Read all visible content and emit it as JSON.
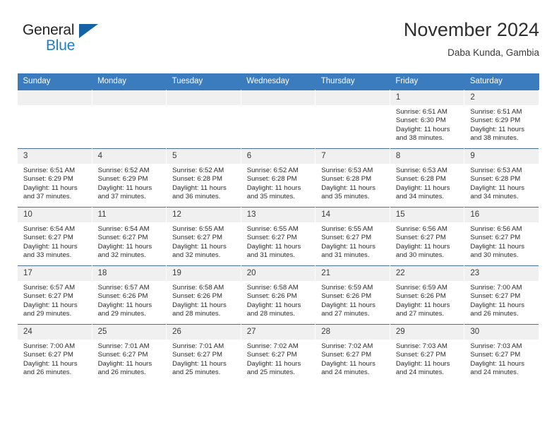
{
  "brand": {
    "name_part1": "General",
    "name_part2": "Blue",
    "logo_icon": "triangle-flag-icon"
  },
  "header": {
    "month_title": "November 2024",
    "location": "Daba Kunda, Gambia"
  },
  "colors": {
    "header_blue": "#3b7cbf",
    "brand_blue": "#1f7fc4",
    "logo_blue": "#1464a5",
    "daynum_band": "#f0f0f0",
    "row_border": "#4b6f9c"
  },
  "weekdays": [
    "Sunday",
    "Monday",
    "Tuesday",
    "Wednesday",
    "Thursday",
    "Friday",
    "Saturday"
  ],
  "weeks": [
    [
      {
        "day": "",
        "empty": true
      },
      {
        "day": "",
        "empty": true
      },
      {
        "day": "",
        "empty": true
      },
      {
        "day": "",
        "empty": true
      },
      {
        "day": "",
        "empty": true
      },
      {
        "day": "1",
        "sunrise": "Sunrise: 6:51 AM",
        "sunset": "Sunset: 6:30 PM",
        "daylight1": "Daylight: 11 hours",
        "daylight2": "and 38 minutes."
      },
      {
        "day": "2",
        "sunrise": "Sunrise: 6:51 AM",
        "sunset": "Sunset: 6:29 PM",
        "daylight1": "Daylight: 11 hours",
        "daylight2": "and 38 minutes."
      }
    ],
    [
      {
        "day": "3",
        "sunrise": "Sunrise: 6:51 AM",
        "sunset": "Sunset: 6:29 PM",
        "daylight1": "Daylight: 11 hours",
        "daylight2": "and 37 minutes."
      },
      {
        "day": "4",
        "sunrise": "Sunrise: 6:52 AM",
        "sunset": "Sunset: 6:29 PM",
        "daylight1": "Daylight: 11 hours",
        "daylight2": "and 37 minutes."
      },
      {
        "day": "5",
        "sunrise": "Sunrise: 6:52 AM",
        "sunset": "Sunset: 6:28 PM",
        "daylight1": "Daylight: 11 hours",
        "daylight2": "and 36 minutes."
      },
      {
        "day": "6",
        "sunrise": "Sunrise: 6:52 AM",
        "sunset": "Sunset: 6:28 PM",
        "daylight1": "Daylight: 11 hours",
        "daylight2": "and 35 minutes."
      },
      {
        "day": "7",
        "sunrise": "Sunrise: 6:53 AM",
        "sunset": "Sunset: 6:28 PM",
        "daylight1": "Daylight: 11 hours",
        "daylight2": "and 35 minutes."
      },
      {
        "day": "8",
        "sunrise": "Sunrise: 6:53 AM",
        "sunset": "Sunset: 6:28 PM",
        "daylight1": "Daylight: 11 hours",
        "daylight2": "and 34 minutes."
      },
      {
        "day": "9",
        "sunrise": "Sunrise: 6:53 AM",
        "sunset": "Sunset: 6:28 PM",
        "daylight1": "Daylight: 11 hours",
        "daylight2": "and 34 minutes."
      }
    ],
    [
      {
        "day": "10",
        "sunrise": "Sunrise: 6:54 AM",
        "sunset": "Sunset: 6:27 PM",
        "daylight1": "Daylight: 11 hours",
        "daylight2": "and 33 minutes."
      },
      {
        "day": "11",
        "sunrise": "Sunrise: 6:54 AM",
        "sunset": "Sunset: 6:27 PM",
        "daylight1": "Daylight: 11 hours",
        "daylight2": "and 32 minutes."
      },
      {
        "day": "12",
        "sunrise": "Sunrise: 6:55 AM",
        "sunset": "Sunset: 6:27 PM",
        "daylight1": "Daylight: 11 hours",
        "daylight2": "and 32 minutes."
      },
      {
        "day": "13",
        "sunrise": "Sunrise: 6:55 AM",
        "sunset": "Sunset: 6:27 PM",
        "daylight1": "Daylight: 11 hours",
        "daylight2": "and 31 minutes."
      },
      {
        "day": "14",
        "sunrise": "Sunrise: 6:55 AM",
        "sunset": "Sunset: 6:27 PM",
        "daylight1": "Daylight: 11 hours",
        "daylight2": "and 31 minutes."
      },
      {
        "day": "15",
        "sunrise": "Sunrise: 6:56 AM",
        "sunset": "Sunset: 6:27 PM",
        "daylight1": "Daylight: 11 hours",
        "daylight2": "and 30 minutes."
      },
      {
        "day": "16",
        "sunrise": "Sunrise: 6:56 AM",
        "sunset": "Sunset: 6:27 PM",
        "daylight1": "Daylight: 11 hours",
        "daylight2": "and 30 minutes."
      }
    ],
    [
      {
        "day": "17",
        "sunrise": "Sunrise: 6:57 AM",
        "sunset": "Sunset: 6:27 PM",
        "daylight1": "Daylight: 11 hours",
        "daylight2": "and 29 minutes."
      },
      {
        "day": "18",
        "sunrise": "Sunrise: 6:57 AM",
        "sunset": "Sunset: 6:26 PM",
        "daylight1": "Daylight: 11 hours",
        "daylight2": "and 29 minutes."
      },
      {
        "day": "19",
        "sunrise": "Sunrise: 6:58 AM",
        "sunset": "Sunset: 6:26 PM",
        "daylight1": "Daylight: 11 hours",
        "daylight2": "and 28 minutes."
      },
      {
        "day": "20",
        "sunrise": "Sunrise: 6:58 AM",
        "sunset": "Sunset: 6:26 PM",
        "daylight1": "Daylight: 11 hours",
        "daylight2": "and 28 minutes."
      },
      {
        "day": "21",
        "sunrise": "Sunrise: 6:59 AM",
        "sunset": "Sunset: 6:26 PM",
        "daylight1": "Daylight: 11 hours",
        "daylight2": "and 27 minutes."
      },
      {
        "day": "22",
        "sunrise": "Sunrise: 6:59 AM",
        "sunset": "Sunset: 6:26 PM",
        "daylight1": "Daylight: 11 hours",
        "daylight2": "and 27 minutes."
      },
      {
        "day": "23",
        "sunrise": "Sunrise: 7:00 AM",
        "sunset": "Sunset: 6:27 PM",
        "daylight1": "Daylight: 11 hours",
        "daylight2": "and 26 minutes."
      }
    ],
    [
      {
        "day": "24",
        "sunrise": "Sunrise: 7:00 AM",
        "sunset": "Sunset: 6:27 PM",
        "daylight1": "Daylight: 11 hours",
        "daylight2": "and 26 minutes."
      },
      {
        "day": "25",
        "sunrise": "Sunrise: 7:01 AM",
        "sunset": "Sunset: 6:27 PM",
        "daylight1": "Daylight: 11 hours",
        "daylight2": "and 26 minutes."
      },
      {
        "day": "26",
        "sunrise": "Sunrise: 7:01 AM",
        "sunset": "Sunset: 6:27 PM",
        "daylight1": "Daylight: 11 hours",
        "daylight2": "and 25 minutes."
      },
      {
        "day": "27",
        "sunrise": "Sunrise: 7:02 AM",
        "sunset": "Sunset: 6:27 PM",
        "daylight1": "Daylight: 11 hours",
        "daylight2": "and 25 minutes."
      },
      {
        "day": "28",
        "sunrise": "Sunrise: 7:02 AM",
        "sunset": "Sunset: 6:27 PM",
        "daylight1": "Daylight: 11 hours",
        "daylight2": "and 24 minutes."
      },
      {
        "day": "29",
        "sunrise": "Sunrise: 7:03 AM",
        "sunset": "Sunset: 6:27 PM",
        "daylight1": "Daylight: 11 hours",
        "daylight2": "and 24 minutes."
      },
      {
        "day": "30",
        "sunrise": "Sunrise: 7:03 AM",
        "sunset": "Sunset: 6:27 PM",
        "daylight1": "Daylight: 11 hours",
        "daylight2": "and 24 minutes."
      }
    ]
  ]
}
